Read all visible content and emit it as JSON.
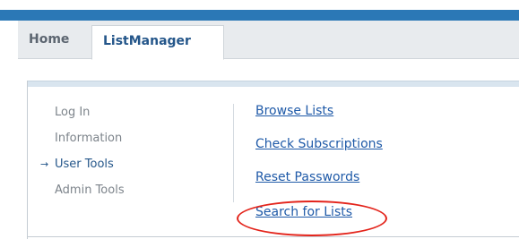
{
  "tabs": [
    {
      "label": "Home",
      "active": false
    },
    {
      "label": "ListManager",
      "active": true
    }
  ],
  "side_nav": {
    "active_marker": "→",
    "items": [
      {
        "label": "Log In",
        "active": false
      },
      {
        "label": "Information",
        "active": false
      },
      {
        "label": "User Tools",
        "active": true
      },
      {
        "label": "Admin Tools",
        "active": false
      }
    ]
  },
  "links": [
    {
      "label": "Browse Lists"
    },
    {
      "label": "Check Subscriptions"
    },
    {
      "label": "Reset Passwords"
    },
    {
      "label": "Search for Lists",
      "highlighted": true
    }
  ],
  "colors": {
    "header_bar": "#2b78b6",
    "link": "#1f5aa8",
    "active_text": "#24568a",
    "highlight_oval": "#e3241b"
  }
}
